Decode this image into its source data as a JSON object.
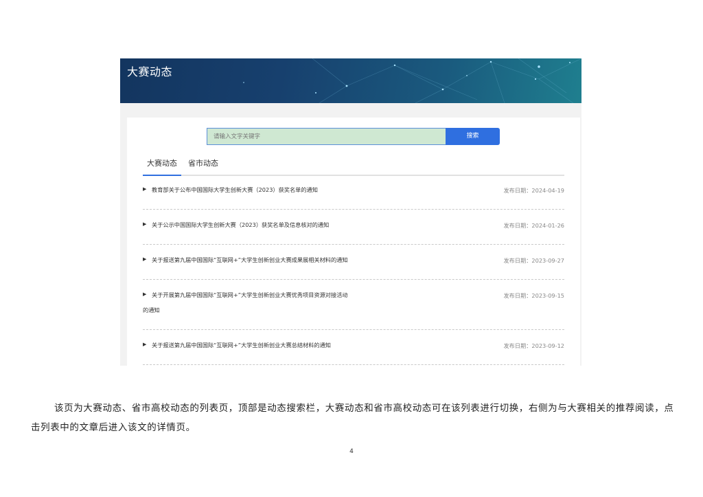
{
  "banner": {
    "title": "大赛动态"
  },
  "search": {
    "placeholder": "请输入文字关键字",
    "button_label": "搜索"
  },
  "tabs": [
    {
      "label": "大赛动态",
      "active": true
    },
    {
      "label": "省市动态",
      "active": false
    }
  ],
  "articles": [
    {
      "title": "教育部关于公布中国国际大学生创新大赛（2023）获奖名单的通知",
      "date": "发布日期：2024-04-19"
    },
    {
      "title": "关于公示中国国际大学生创新大赛（2023）获奖名单及信息核对的通知",
      "date": "发布日期：2024-01-26"
    },
    {
      "title": "关于报送第九届中国国际“互联网+”大学生创新创业大赛成果展相关材料的通知",
      "date": "发布日期：2023-09-27"
    },
    {
      "title": "关于开展第九届中国国际“互联网+”大学生创新创业大赛优秀项目资源对接活动",
      "title_cont": "的通知",
      "date": "发布日期：2023-09-15"
    },
    {
      "title": "关于报送第九届中国国际“互联网+”大学生创新创业大赛总结材料的通知",
      "date": "发布日期：2023-09-12"
    }
  ],
  "arrow_icon": "▶",
  "caption": "该页为大赛动态、省市高校动态的列表页，顶部是动态搜索栏，大赛动态和省市高校动态可在该列表进行切换，右侧为与大赛相关的推荐阅读，点击列表中的文章后进入该文的详情页。",
  "page_number": "4",
  "colors": {
    "accent": "#2f6fe0",
    "banner_dark": "#13355f",
    "search_bg": "#cfe8d2"
  }
}
